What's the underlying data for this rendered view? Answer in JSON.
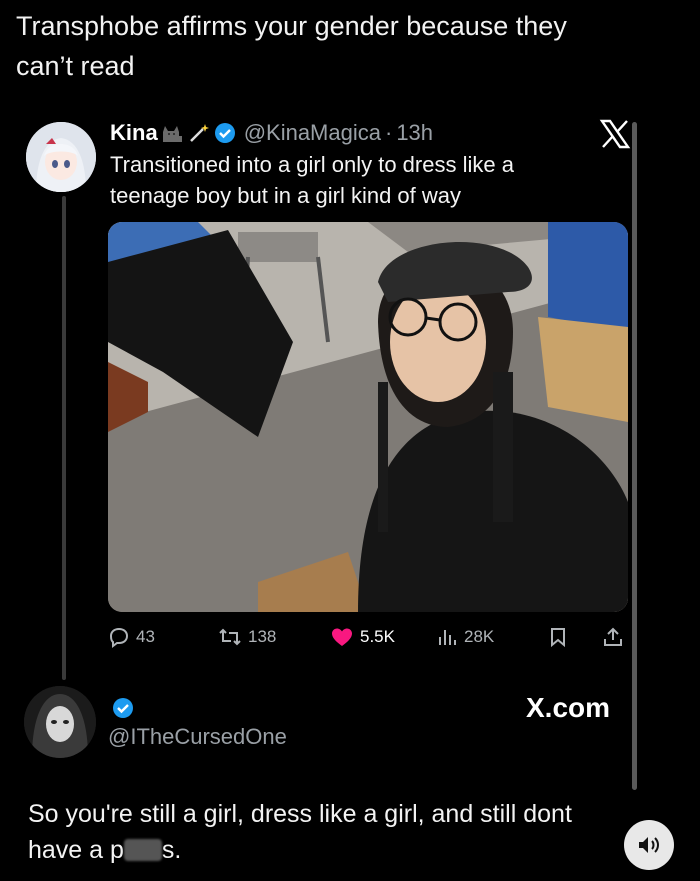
{
  "caption": {
    "line1": "Transphobe affirms your gender because they",
    "line2": "can’t read"
  },
  "tweet": {
    "name": "Kina",
    "handle": "@KinaMagica",
    "separator": "·",
    "time": "13h",
    "text": "Transitioned into a girl only to dress like a teenage boy but in a girl kind of way",
    "stats": {
      "replies": "43",
      "reposts": "138",
      "likes": "5.5K",
      "views": "28K"
    }
  },
  "reply_tweet": {
    "handle": "@ITheCursedOne",
    "text_before": "So you're still a girl, dress like a girl, and still dont",
    "text_line2_start": "have a p",
    "text_line2_end": "s."
  },
  "watermark": "X.com",
  "colors": {
    "background": "#000000",
    "like": "#f91880",
    "verified": "#1d9bf0",
    "muted": "#9aa0a6"
  },
  "icons": [
    "x-logo-icon",
    "verified-badge-icon",
    "cat-emoji-icon",
    "magic-wand-emoji-icon",
    "reply-icon",
    "repost-icon",
    "like-icon",
    "views-icon",
    "bookmark-icon",
    "share-icon",
    "sound-icon"
  ]
}
